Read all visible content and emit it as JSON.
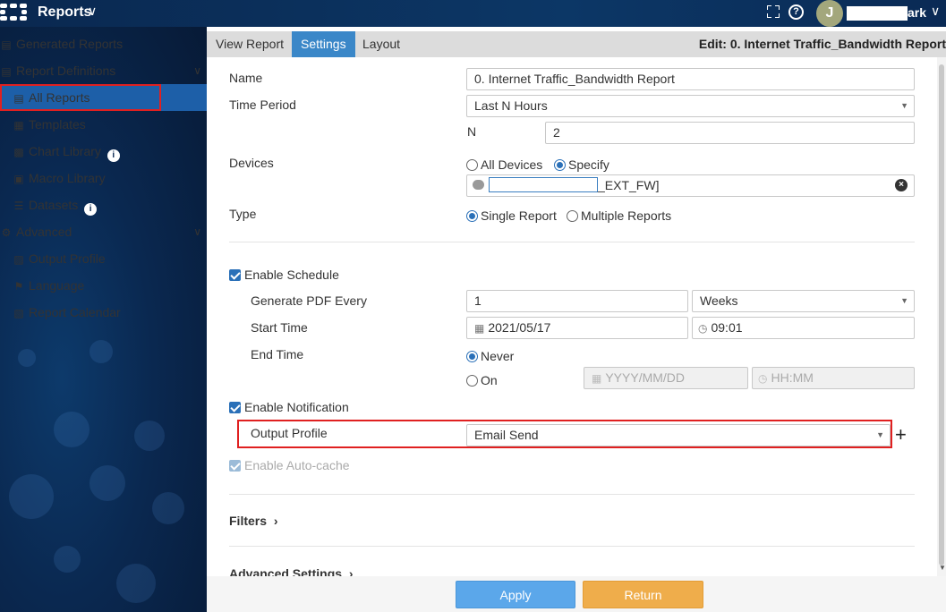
{
  "app": {
    "title": "Reports"
  },
  "user": {
    "avatar_initial": "J",
    "name_suffix": "ark"
  },
  "sidebar": {
    "items": [
      {
        "label": "Generated Reports"
      },
      {
        "label": "Report Definitions"
      },
      {
        "label": "All Reports"
      },
      {
        "label": "Templates"
      },
      {
        "label": "Chart Library"
      },
      {
        "label": "Macro Library"
      },
      {
        "label": "Datasets"
      },
      {
        "label": "Advanced"
      },
      {
        "label": "Output Profile"
      },
      {
        "label": "Language"
      },
      {
        "label": "Report Calendar"
      }
    ]
  },
  "tabs": [
    {
      "label": "View Report"
    },
    {
      "label": "Settings"
    },
    {
      "label": "Layout"
    }
  ],
  "edit_title": "Edit: 0. Internet Traffic_Bandwidth Report",
  "form": {
    "name_label": "Name",
    "name_value": "0. Internet Traffic_Bandwidth Report",
    "time_period_label": "Time Period",
    "time_period_value": "Last N Hours",
    "n_label": "N",
    "n_value": "2",
    "devices_label": "Devices",
    "all_devices_label": "All Devices",
    "specify_label": "Specify",
    "device_suffix": "_EXT_FW]",
    "type_label": "Type",
    "single_report_label": "Single Report",
    "multiple_reports_label": "Multiple Reports",
    "enable_schedule_label": "Enable Schedule",
    "generate_pdf_label": "Generate PDF Every",
    "generate_pdf_value": "1",
    "period_unit_value": "Weeks",
    "start_time_label": "Start Time",
    "start_date_value": "2021/05/17",
    "start_time_value": "09:01",
    "end_time_label": "End Time",
    "never_label": "Never",
    "on_label": "On",
    "end_date_placeholder": "YYYY/MM/DD",
    "end_time_placeholder": "HH:MM",
    "enable_notification_label": "Enable Notification",
    "output_profile_label": "Output Profile",
    "output_profile_value": "Email Send",
    "enable_autocache_label": "Enable Auto-cache",
    "filters_label": "Filters",
    "advanced_settings_label": "Advanced Settings"
  },
  "buttons": {
    "apply": "Apply",
    "return": "Return"
  },
  "colors": {
    "accent": "#3a87c8",
    "apply": "#5ba7ea",
    "return": "#efad4b",
    "highlight": "#e02020"
  }
}
